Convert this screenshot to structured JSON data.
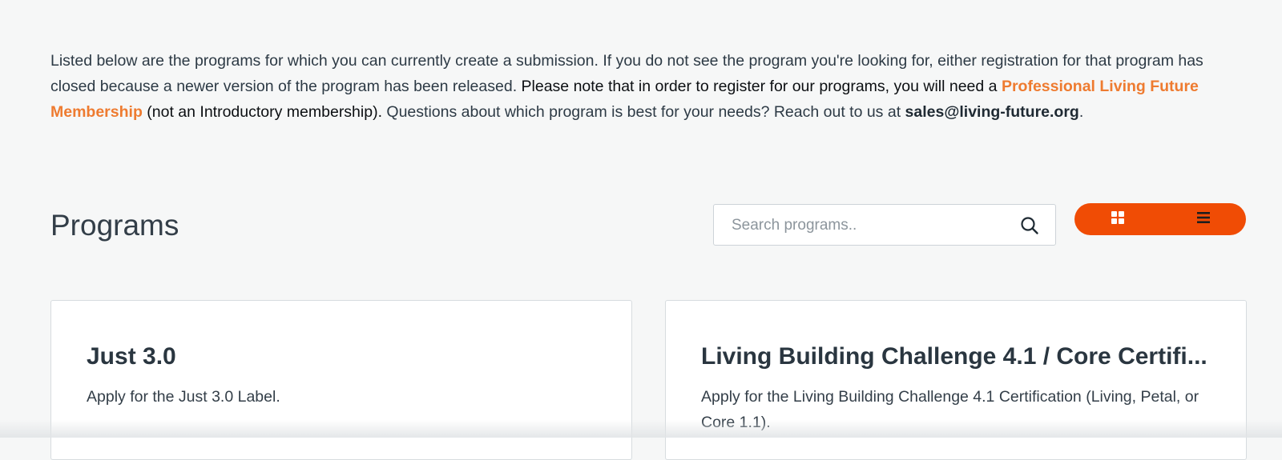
{
  "intro": {
    "part1": "Listed below are the programs for which you can currently create a submission. If you do not see the program you're looking for, either registration for that program has closed because a newer version of the program has been released.",
    "part2": "Please note that in order to register for our programs, you will need a",
    "link_text": "Professional Living Future Membership",
    "part3": "(not an Introductory membership).",
    "part4": "Questions about which program is best for your needs? Reach out to us at",
    "email": "sales@living-future.org",
    "period": "."
  },
  "programs": {
    "title": "Programs",
    "search_placeholder": "Search programs..",
    "search_value": ""
  },
  "view_toggle": {
    "accent": "#f04c05",
    "options": [
      {
        "icon": "grid-icon",
        "active": true
      },
      {
        "icon": "list-icon",
        "active": false
      }
    ]
  },
  "cards": [
    {
      "title": "Just 3.0",
      "description": "Apply for the Just 3.0 Label."
    },
    {
      "title": "Living Building Challenge 4.1 / Core Certifi...",
      "description": "Apply for the Living Building Challenge 4.1 Certification (Living, Petal, or Core 1.1)."
    }
  ],
  "colors": {
    "background": "#f6f7f7",
    "link": "#ee7b30",
    "text": "#333e48"
  }
}
